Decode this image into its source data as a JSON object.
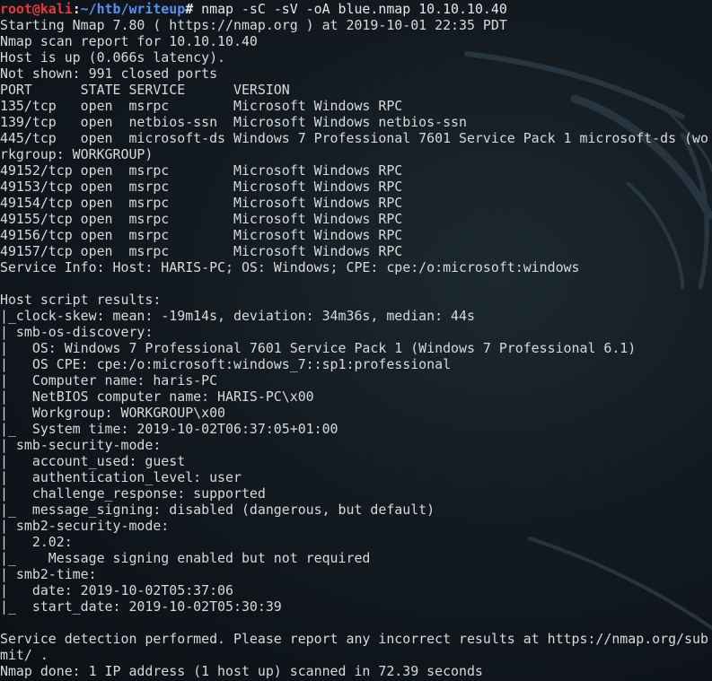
{
  "prompt": {
    "user": "root@kali",
    "sep": ":",
    "path": "~/htb/writeup",
    "hash": "#",
    "command": " nmap -sC -sV -oA blue.nmap 10.10.10.40"
  },
  "output": [
    "Starting Nmap 7.80 ( https://nmap.org ) at 2019-10-01 22:35 PDT",
    "Nmap scan report for 10.10.10.40",
    "Host is up (0.066s latency).",
    "Not shown: 991 closed ports",
    "PORT      STATE SERVICE      VERSION",
    "135/tcp   open  msrpc        Microsoft Windows RPC",
    "139/tcp   open  netbios-ssn  Microsoft Windows netbios-ssn",
    "445/tcp   open  microsoft-ds Windows 7 Professional 7601 Service Pack 1 microsoft-ds (wo",
    "rkgroup: WORKGROUP)",
    "49152/tcp open  msrpc        Microsoft Windows RPC",
    "49153/tcp open  msrpc        Microsoft Windows RPC",
    "49154/tcp open  msrpc        Microsoft Windows RPC",
    "49155/tcp open  msrpc        Microsoft Windows RPC",
    "49156/tcp open  msrpc        Microsoft Windows RPC",
    "49157/tcp open  msrpc        Microsoft Windows RPC",
    "Service Info: Host: HARIS-PC; OS: Windows; CPE: cpe:/o:microsoft:windows",
    "",
    "Host script results:",
    "|_clock-skew: mean: -19m14s, deviation: 34m36s, median: 44s",
    "| smb-os-discovery:",
    "|   OS: Windows 7 Professional 7601 Service Pack 1 (Windows 7 Professional 6.1)",
    "|   OS CPE: cpe:/o:microsoft:windows_7::sp1:professional",
    "|   Computer name: haris-PC",
    "|   NetBIOS computer name: HARIS-PC\\x00",
    "|   Workgroup: WORKGROUP\\x00",
    "|_  System time: 2019-10-02T06:37:05+01:00",
    "| smb-security-mode:",
    "|   account_used: guest",
    "|   authentication_level: user",
    "|   challenge_response: supported",
    "|_  message_signing: disabled (dangerous, but default)",
    "| smb2-security-mode:",
    "|   2.02:",
    "|_    Message signing enabled but not required",
    "| smb2-time:",
    "|   date: 2019-10-02T05:37:06",
    "|_  start_date: 2019-10-02T05:30:39",
    "",
    "Service detection performed. Please report any incorrect results at https://nmap.org/sub",
    "mit/ .",
    "Nmap done: 1 IP address (1 host up) scanned in 72.39 seconds"
  ],
  "colors": {
    "background": "#121a20",
    "text": "#d9d9d9",
    "prompt_user": "#e8393a",
    "prompt_path": "#5a8ff0"
  }
}
